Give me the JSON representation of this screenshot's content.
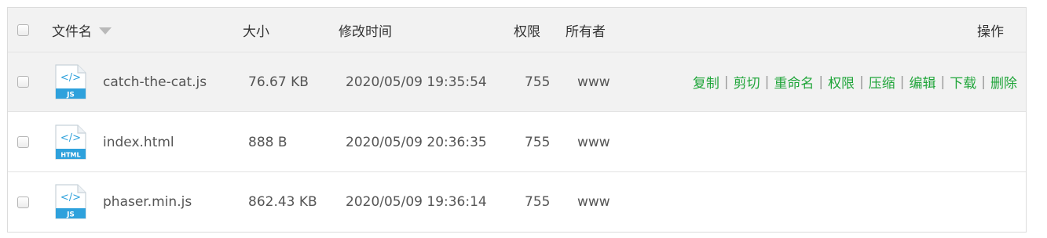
{
  "header": {
    "name_label": "文件名",
    "size_label": "大小",
    "mtime_label": "修改时间",
    "perm_label": "权限",
    "owner_label": "所有者",
    "ops_label": "操作"
  },
  "files": [
    {
      "name": "catch-the-cat.js",
      "type_label": "JS",
      "size": "76.67 KB",
      "mtime": "2020/05/09 19:35:54",
      "perm": "755",
      "owner": "www",
      "actions": [
        "复制",
        "剪切",
        "重命名",
        "权限",
        "压缩",
        "编辑",
        "下载",
        "删除"
      ]
    },
    {
      "name": "index.html",
      "type_label": "HTML",
      "size": "888 B",
      "mtime": "2020/05/09 20:36:35",
      "perm": "755",
      "owner": "www"
    },
    {
      "name": "phaser.min.js",
      "type_label": "JS",
      "size": "862.43 KB",
      "mtime": "2020/05/09 19:36:14",
      "perm": "755",
      "owner": "www"
    }
  ],
  "colors": {
    "action_link": "#20a53a",
    "icon_blue": "#2ea1dc",
    "header_bg": "#f2f2f2",
    "hover_bg": "#f2f2f2"
  },
  "icons": {
    "file": "code-file-icon",
    "sort": "sort-desc-icon",
    "checkbox": "checkbox"
  }
}
